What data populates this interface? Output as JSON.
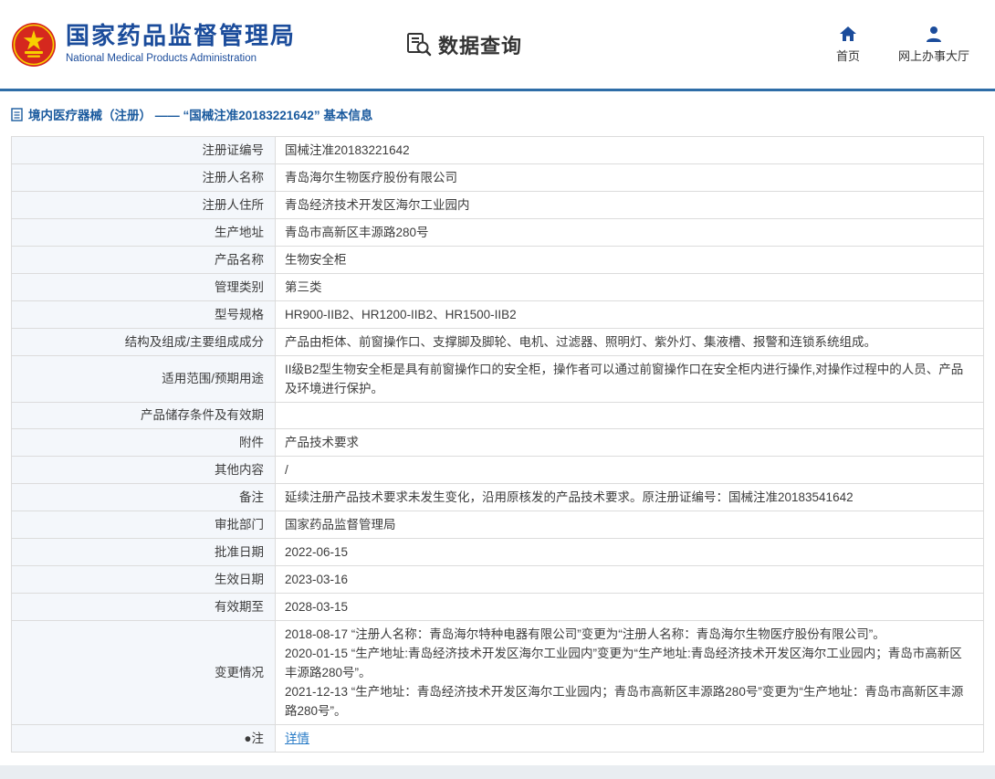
{
  "header": {
    "org_name_cn": "国家药品监督管理局",
    "org_name_en": "National Medical Products Administration",
    "section_title": "数据查询",
    "nav": [
      {
        "label": "首页",
        "icon": "home-icon"
      },
      {
        "label": "网上办事大厅",
        "icon": "user-icon"
      }
    ]
  },
  "colors": {
    "brand_blue": "#1b4c9b",
    "divider_blue": "#2e6da7",
    "label_cell_bg": "#f4f7fb",
    "link_blue": "#2a7cc7",
    "emblem_red": "#d5281e",
    "emblem_gold": "#f8d000"
  },
  "breadcrumb": {
    "text": "境内医疗器械（注册） —— “国械注准20183221642” 基本信息"
  },
  "table": {
    "rows": [
      {
        "label": "注册证编号",
        "value": "国械注准20183221642"
      },
      {
        "label": "注册人名称",
        "value": "青岛海尔生物医疗股份有限公司"
      },
      {
        "label": "注册人住所",
        "value": "青岛经济技术开发区海尔工业园内"
      },
      {
        "label": "生产地址",
        "value": "青岛市高新区丰源路280号"
      },
      {
        "label": "产品名称",
        "value": "生物安全柜"
      },
      {
        "label": "管理类别",
        "value": "第三类"
      },
      {
        "label": "型号规格",
        "value": "HR900-IIB2、HR1200-IIB2、HR1500-IIB2"
      },
      {
        "label": "结构及组成/主要组成成分",
        "value": "产品由柜体、前窗操作口、支撑脚及脚轮、电机、过滤器、照明灯、紫外灯、集液槽、报警和连锁系统组成。"
      },
      {
        "label": "适用范围/预期用途",
        "value": "II级B2型生物安全柜是具有前窗操作口的安全柜，操作者可以通过前窗操作口在安全柜内进行操作,对操作过程中的人员、产品及环境进行保护。"
      },
      {
        "label": "产品储存条件及有效期",
        "value": ""
      },
      {
        "label": "附件",
        "value": "产品技术要求"
      },
      {
        "label": "其他内容",
        "value": "/"
      },
      {
        "label": "备注",
        "value": "延续注册产品技术要求未发生变化，沿用原核发的产品技术要求。原注册证编号：国械注准20183541642"
      },
      {
        "label": "审批部门",
        "value": "国家药品监督管理局"
      },
      {
        "label": "批准日期",
        "value": "2022-06-15"
      },
      {
        "label": "生效日期",
        "value": "2023-03-16"
      },
      {
        "label": "有效期至",
        "value": "2028-03-15"
      },
      {
        "label": "变更情况",
        "value": "2018-08-17 “注册人名称：青岛海尔特种电器有限公司”变更为“注册人名称：青岛海尔生物医疗股份有限公司”。\n2020-01-15 “生产地址:青岛经济技术开发区海尔工业园内”变更为“生产地址:青岛经济技术开发区海尔工业园内；青岛市高新区丰源路280号”。\n2021-12-13 “生产地址：青岛经济技术开发区海尔工业园内；青岛市高新区丰源路280号”变更为“生产地址：青岛市高新区丰源路280号”。"
      },
      {
        "label": "●注",
        "value": "详情",
        "link": true
      }
    ]
  }
}
